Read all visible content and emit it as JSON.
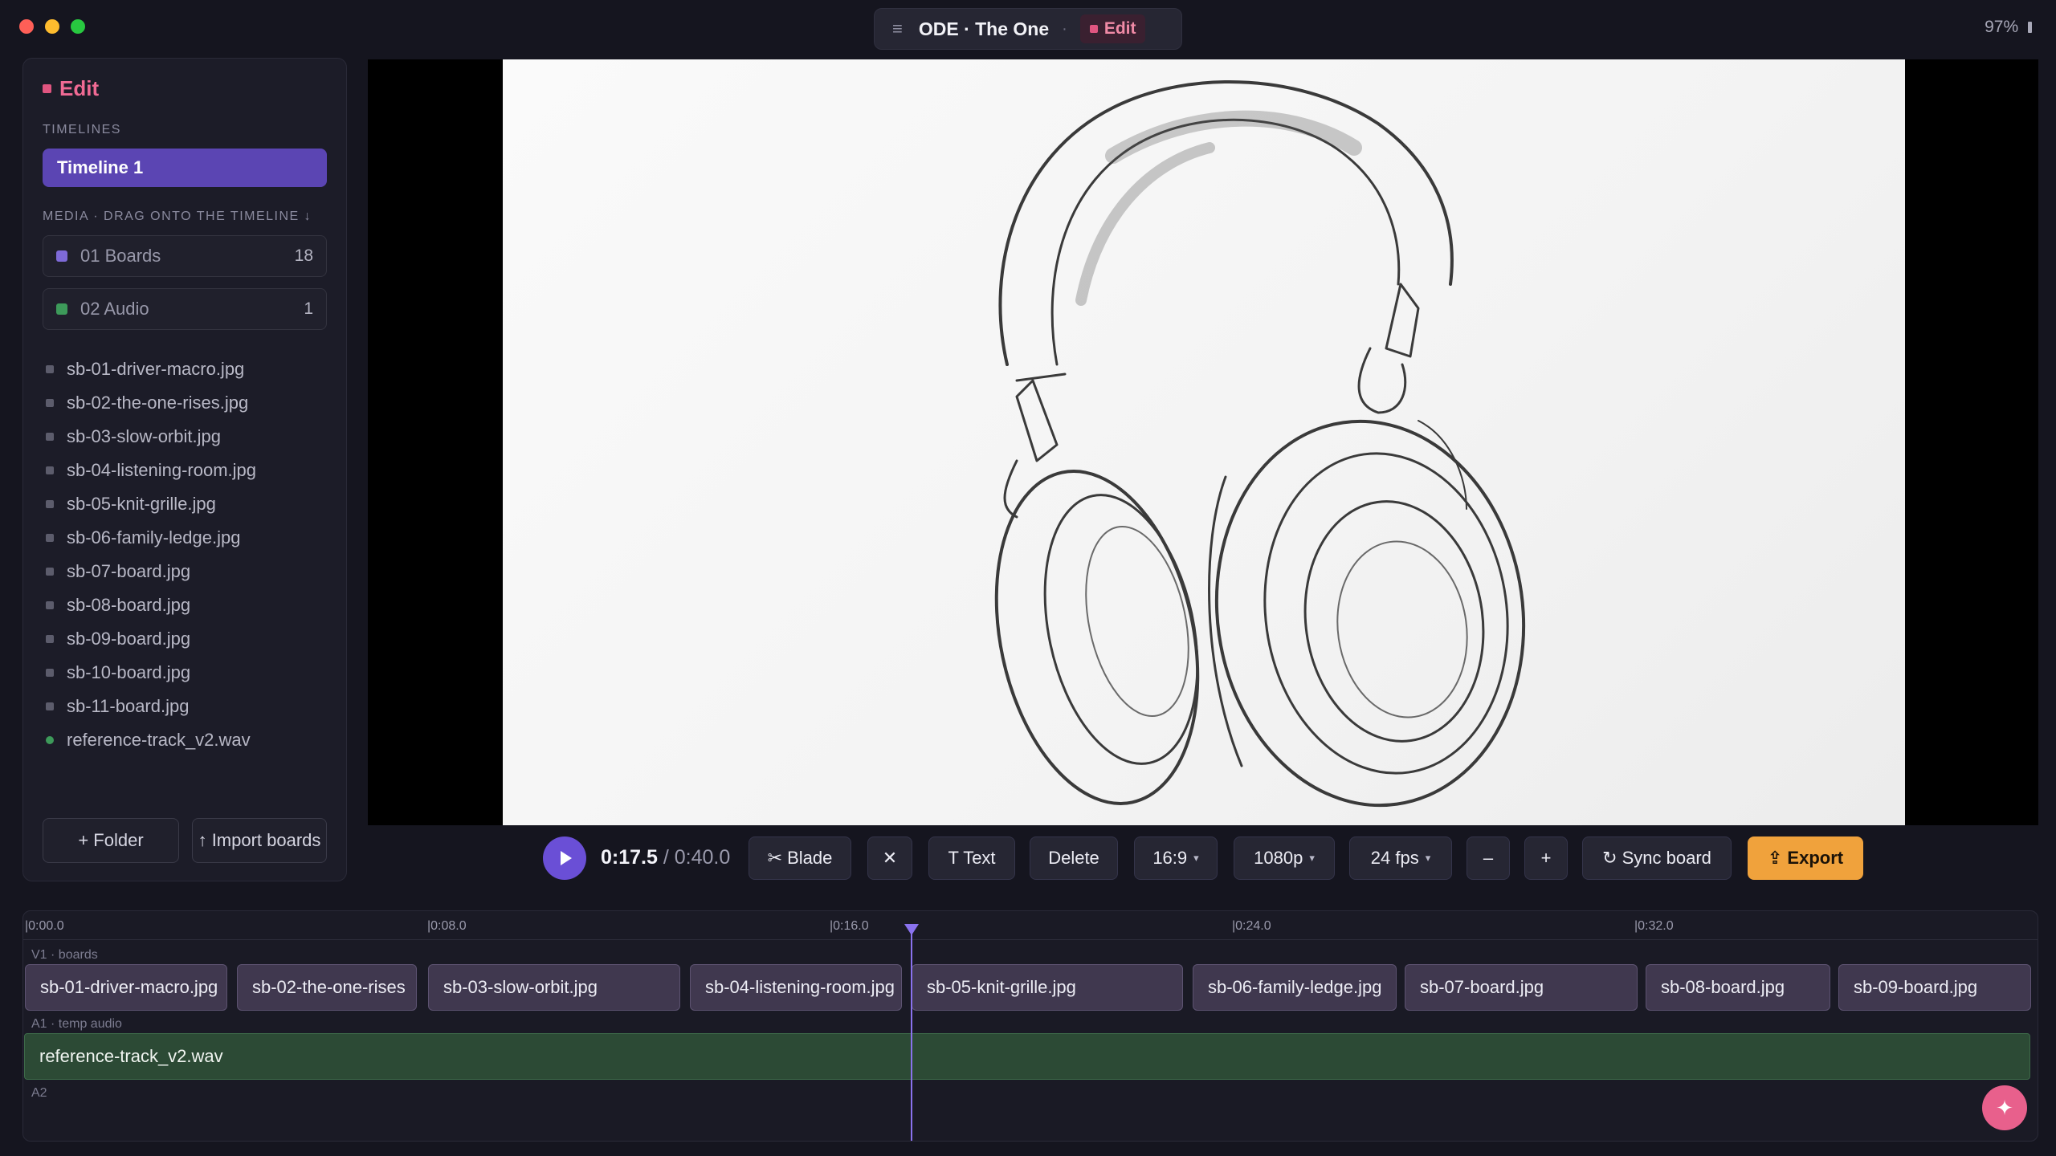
{
  "window": {
    "project_title": "ODE · The One",
    "title_separator": "·",
    "mode": "Edit",
    "battery": "97%",
    "menu_icon": "hamburger-icon"
  },
  "sidebar": {
    "mode_label": "Edit",
    "timelines_label": "TIMELINES",
    "timelines": [
      "Timeline 1"
    ],
    "media_label": "MEDIA · DRAG ONTO THE TIMELINE ↓",
    "folders": [
      {
        "name": "01 Boards",
        "count": "18",
        "color": "#7e6ad8"
      },
      {
        "name": "02 Audio",
        "count": "1",
        "color": "#3d9a5a"
      }
    ],
    "files": [
      "sb-01-driver-macro.jpg",
      "sb-02-the-one-rises.jpg",
      "sb-03-slow-orbit.jpg",
      "sb-04-listening-room.jpg",
      "sb-05-knit-grille.jpg",
      "sb-06-family-ledge.jpg",
      "sb-07-board.jpg",
      "sb-08-board.jpg",
      "sb-09-board.jpg",
      "sb-10-board.jpg",
      "sb-11-board.jpg",
      "reference-track_v2.wav"
    ],
    "add_folder_label": "+ Folder",
    "import_label": "↑ Import boards"
  },
  "toolbar": {
    "current_time": "0:17.5",
    "total_time": " / 0:40.0",
    "blade_label": "✂ Blade",
    "close_label": "✕",
    "text_label": "T Text",
    "delete_label": "Delete",
    "aspect_label": "16:9",
    "resolution_label": "1080p",
    "fps_label": "24 fps",
    "zoom_out_label": "–",
    "zoom_in_label": "+",
    "sync_label": "↻ Sync board",
    "export_label": "⇪ Export",
    "caret": "▾"
  },
  "timeline": {
    "ticks": [
      "|0:00.0",
      "|0:08.0",
      "|0:16.0",
      "|0:24.0",
      "|0:32.0"
    ],
    "v1_label": "V1 · boards",
    "a1_label": "A1 · temp audio",
    "a2_label": "A2",
    "clips": [
      "sb-01-driver-macro.jpg",
      "sb-02-the-one-rises",
      "sb-03-slow-orbit.jpg",
      "sb-04-listening-room.jpg",
      "sb-05-knit-grille.jpg",
      "sb-06-family-ledge.jpg",
      "sb-07-board.jpg",
      "sb-08-board.jpg",
      "sb-09-board.jpg"
    ],
    "audio_clip": "reference-track_v2.wav",
    "playhead_time": "0:17.5",
    "fab_icon": "✦"
  },
  "colors": {
    "accent": "#6a4fd6",
    "edit_pink": "#e05580",
    "export_orange": "#f0a23c",
    "audio_green": "#2c4a35"
  }
}
